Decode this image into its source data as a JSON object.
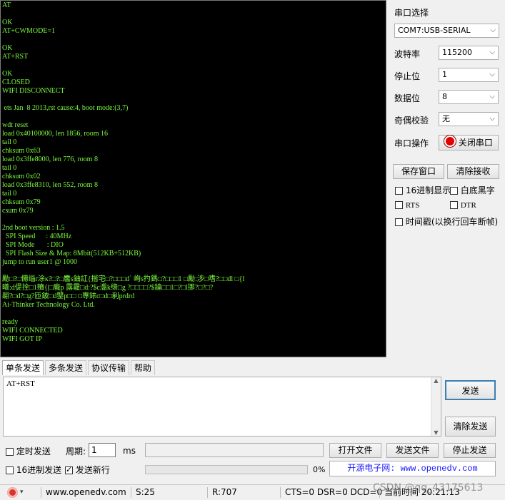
{
  "terminal": {
    "lines": [
      "AT",
      "",
      "OK",
      "AT+CWMODE=1",
      "",
      "OK",
      "AT+RST",
      "",
      "OK",
      "CLOSED",
      "WIFI DISCONNECT",
      "",
      " ets Jan  8 2013,rst cause:4, boot mode:(3,7)",
      "",
      "wdt reset",
      "load 0x40100000, len 1856, room 16",
      "tail 0",
      "chksum 0x63",
      "load 0x3ffe8000, len 776, room 8",
      "tail 0",
      "chksum 0x02",
      "load 0x3ffe8310, len 552, room 8",
      "tail 0",
      "chksum 0x79",
      "csum 0x79",
      "",
      "2nd boot version : 1.5",
      "  SPI Speed      : 40MHz",
      "  SPI Mode       : DIO",
      "  SPI Flash Size & Map: 8Mbit(512KB+512KB)",
      "jump to run user1 @ 1000",
      "",
      "勵□?□儞缁r涂κ?□?□麢s鈾訌{揩宅□?□□□d` 峋s扚鎷□?□□□1 □勵:涉□嗜?□□dl □{l",
      "曦:d偍拴□1贖{|□龐p 露龗□d:?$c瀊k缞□g ?□□□□?$鑰□□1□?□l挪?□?□?",
      "翿?□d?□g?匝鈹□d鑍p□□ □專銥c□d□剢prdrd",
      "Ai-Thinker Technology Co. Ltd.",
      "",
      "ready",
      "WIFI CONNECTED",
      "WIFI GOT IP"
    ]
  },
  "settings": {
    "port_select_label": "串口选择",
    "port_value": "COM7:USB-SERIAL",
    "baud_label": "波特率",
    "baud_value": "115200",
    "stopbits_label": "停止位",
    "stopbits_value": "1",
    "databits_label": "数据位",
    "databits_value": "8",
    "parity_label": "奇偶校验",
    "parity_value": "无",
    "port_op_label": "串口操作",
    "close_port_label": "关闭串口",
    "save_window_label": "保存窗口",
    "clear_receive_label": "清除接收",
    "hex_display_label": "16进制显示",
    "white_bg_label": "白底黑字",
    "rts_label": "RTS",
    "dtr_label": "DTR",
    "timestamp_label": "时间戳(以换行回车断帧)"
  },
  "tabs": [
    "单条发送",
    "多条发送",
    "协议传输",
    "帮助"
  ],
  "send": {
    "text": "AT+RST",
    "send_button": "发送",
    "clear_send_button": "清除发送",
    "timed_send_label": "定时发送",
    "period_label": "周期:",
    "period_value": "1",
    "period_unit": "ms",
    "open_file_button": "打开文件",
    "send_file_button": "发送文件",
    "stop_send_button": "停止发送",
    "hex_send_label": "16进制发送",
    "send_newline_label": "发送新行",
    "progress_text": "0%",
    "progress_fraction": 0,
    "promo_text": "开源电子网: www.openedv.com"
  },
  "statusbar": {
    "url": "www.openedv.com",
    "sent": "S:25",
    "received": "R:707",
    "signals": "CTS=0 DSR=0 DCD=0",
    "time": "当前时间 20:21:13",
    "watermark": "CSDN @qq_43175613"
  },
  "colors": {
    "terminal_bg": "#000000",
    "terminal_fg": "#7cfc3c",
    "close_port_indicator": "#e00000",
    "promo_text": "#1a1aff"
  }
}
